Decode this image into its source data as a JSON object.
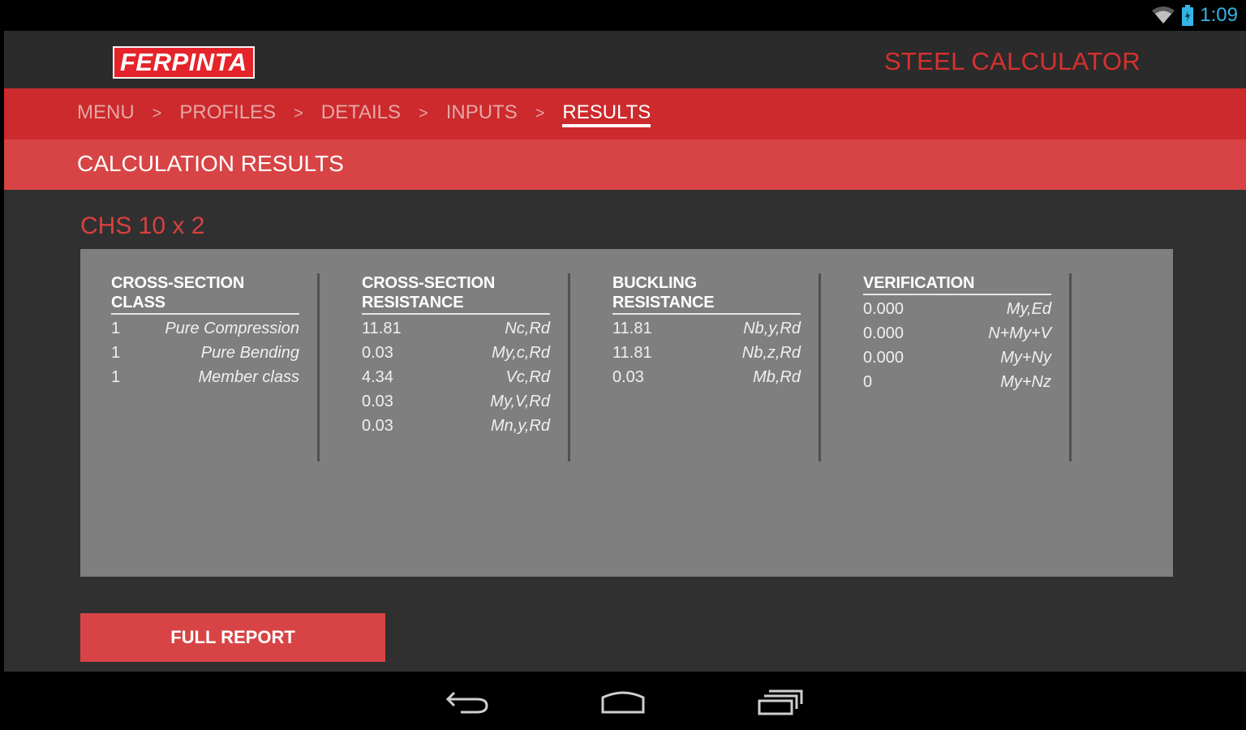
{
  "status_bar": {
    "time": "1:09",
    "icons": [
      "wifi-icon",
      "battery-icon"
    ]
  },
  "header": {
    "logo": "FERPINTA",
    "app_title": "STEEL CALCULATOR"
  },
  "breadcrumb": [
    {
      "label": "MENU",
      "active": false
    },
    {
      "label": "PROFILES",
      "active": false
    },
    {
      "label": "DETAILS",
      "active": false
    },
    {
      "label": "INPUTS",
      "active": false
    },
    {
      "label": "RESULTS",
      "active": true
    }
  ],
  "breadcrumb_separator": ">",
  "section_title": "CALCULATION RESULTS",
  "profile": "CHS 10 x 2",
  "columns": [
    {
      "title": "CROSS-SECTION CLASS",
      "rows": [
        {
          "value": "1",
          "label": "Pure Compression"
        },
        {
          "value": "1",
          "label": "Pure Bending"
        },
        {
          "value": "1",
          "label": "Member class"
        }
      ]
    },
    {
      "title": "CROSS-SECTION RESISTANCE",
      "rows": [
        {
          "value": "11.81",
          "label": "Nc,Rd"
        },
        {
          "value": "0.03",
          "label": "My,c,Rd"
        },
        {
          "value": "4.34",
          "label": "Vc,Rd"
        },
        {
          "value": "0.03",
          "label": "My,V,Rd"
        },
        {
          "value": "0.03",
          "label": "Mn,y,Rd"
        }
      ]
    },
    {
      "title": "BUCKLING RESISTANCE",
      "rows": [
        {
          "value": "11.81",
          "label": "Nb,y,Rd"
        },
        {
          "value": "11.81",
          "label": "Nb,z,Rd"
        },
        {
          "value": "0.03",
          "label": "Mb,Rd"
        }
      ]
    },
    {
      "title": "VERIFICATION",
      "rows": [
        {
          "value": "0.000",
          "label": "My,Ed"
        },
        {
          "value": "0.000",
          "label": "N+My+V"
        },
        {
          "value": "0.000",
          "label": "My+Ny"
        },
        {
          "value": "0",
          "label": "My+Nz"
        }
      ]
    }
  ],
  "full_report_label": "FULL REPORT",
  "colors": {
    "accent": "#cc2a2c",
    "section": "#d84445",
    "panel": "#7f7f7f",
    "background": "#303030",
    "status_accent": "#33b5e5"
  }
}
